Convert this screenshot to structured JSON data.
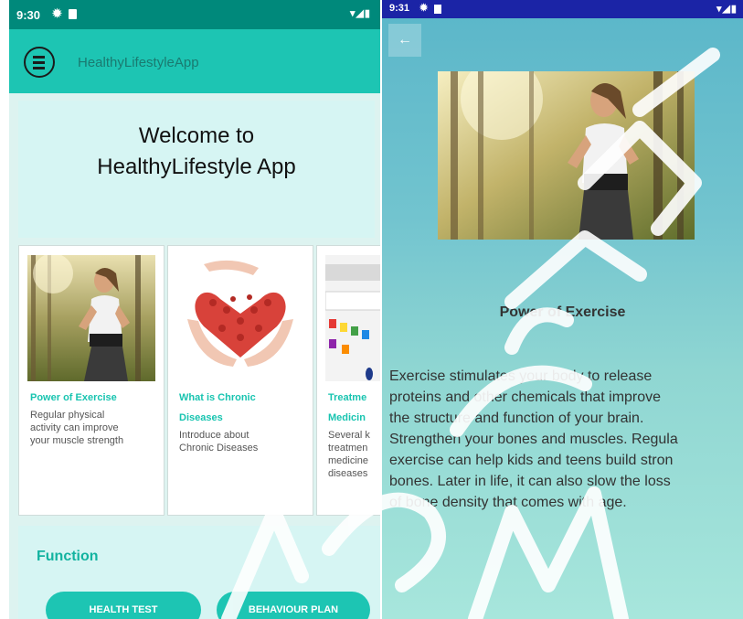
{
  "left_screen": {
    "status_bar": {
      "time": "9:30",
      "system_icons": "▾◢▮"
    },
    "app_bar": {
      "title": "HealthyLifestyleApp"
    },
    "welcome": {
      "line1": "Welcome to",
      "line2": "HealthyLifestyle App"
    },
    "cards": [
      {
        "title_lines": [
          "Power of Exercise"
        ],
        "description_lines": [
          "Regular physical",
          "activity can improve",
          "your muscle strength"
        ]
      },
      {
        "title_lines": [
          "What is Chronic",
          "Diseases"
        ],
        "description_lines": [
          "Introduce about",
          "Chronic Diseases"
        ]
      },
      {
        "title_lines": [
          "Treatme",
          "Medicin"
        ],
        "description_lines": [
          "Several k",
          "treatmen",
          "medicine",
          "diseases"
        ]
      }
    ],
    "function": {
      "title": "Function",
      "buttons": [
        "HEALTH TEST",
        "BEHAVIOUR PLAN"
      ]
    }
  },
  "right_screen": {
    "status_bar": {
      "time": "9:31",
      "system_icons": "▾◢▮"
    },
    "detail": {
      "title": "Power of Exercise",
      "body_lines": [
        "Exercise stimulates your body to release",
        "proteins and other chemicals that improve",
        "the structure and function of your brain.",
        "Strengthen your bones and muscles. Regula",
        "exercise can help kids and teens build stron",
        "bones. Later in life, it can also slow the loss",
        "of bone density that comes with age."
      ]
    }
  },
  "icons": {
    "menu": "menu-circle-icon",
    "settings": "gear-icon",
    "sd_card": "sd-card-icon",
    "back": "back-arrow-icon"
  },
  "colors": {
    "primary_dark": "#00897b",
    "primary": "#1dc5b3",
    "card_tint": "#d6f5f3",
    "accent_text": "#18c4b0",
    "status_right": "#1b24a6"
  }
}
